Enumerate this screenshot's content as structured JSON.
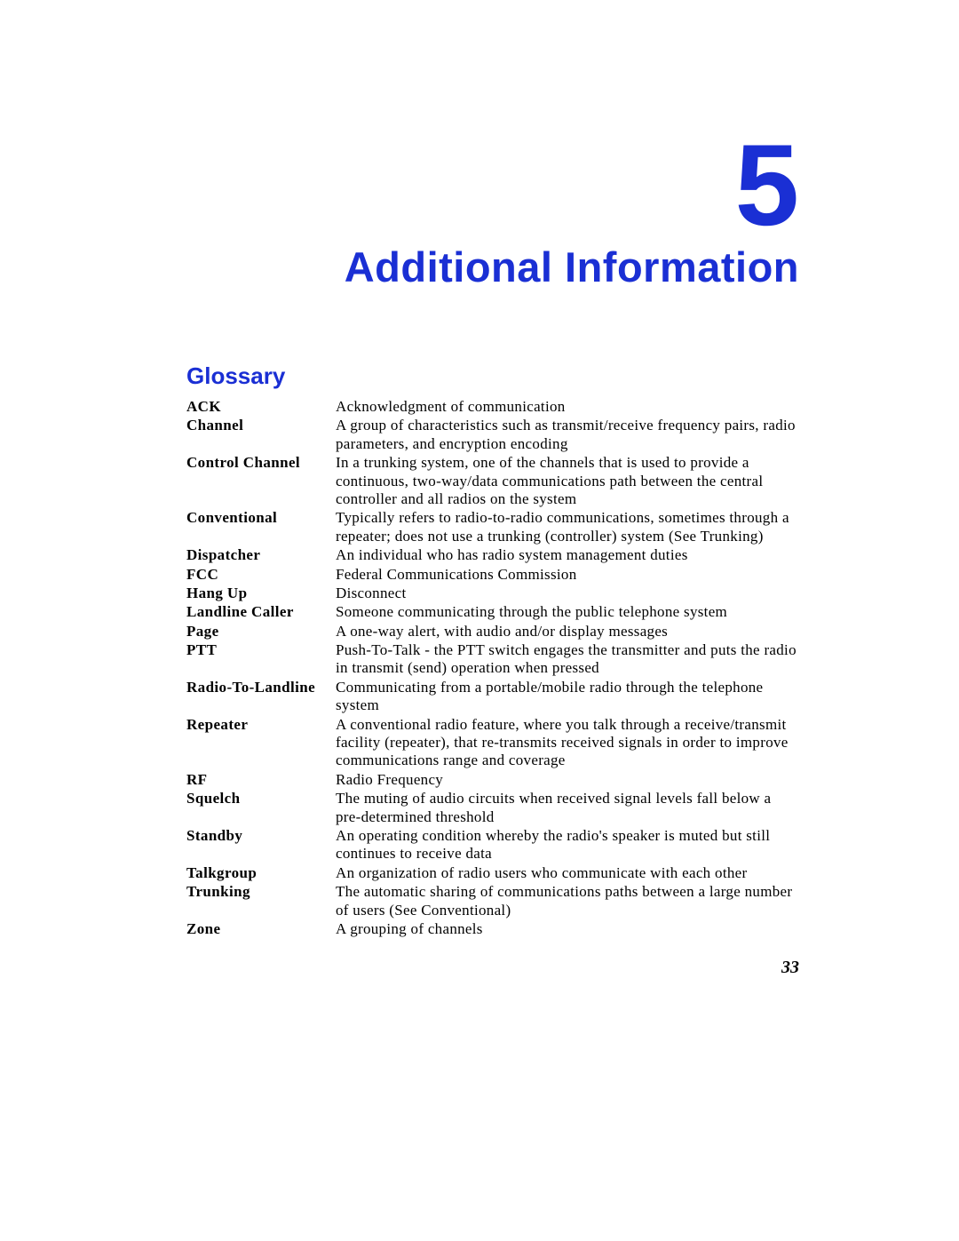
{
  "chapter": {
    "number": "5",
    "title": "Additional Information"
  },
  "section_title": "Glossary",
  "glossary": [
    {
      "term": "ACK",
      "def": "Acknowledgment of communication"
    },
    {
      "term": "Channel",
      "def": "A group of characteristics such as transmit/receive frequency pairs, radio parameters, and encryption encoding"
    },
    {
      "term": "Control Channel",
      "def": "In a trunking system, one of the channels that is used to provide a continuous, two-way/data communications path between the central controller and all radios on the system"
    },
    {
      "term": "Conventional",
      "def": "Typically refers to radio-to-radio communications, sometimes through a repeater; does not use a trunking (controller) system (See Trunking)"
    },
    {
      "term": "Dispatcher",
      "def": "An individual who has radio system management duties"
    },
    {
      "term": "FCC",
      "def": "Federal Communications Commission"
    },
    {
      "term": "Hang Up",
      "def": "Disconnect"
    },
    {
      "term": "Landline Caller",
      "def": "Someone communicating through the public telephone system"
    },
    {
      "term": "Page",
      "def": "A one-way alert, with audio and/or display messages"
    },
    {
      "term": "PTT",
      "def": "Push-To-Talk - the PTT switch engages the transmitter and puts the radio in transmit (send) operation when pressed"
    },
    {
      "term": "Radio-To-Landline",
      "def": "Communicating from a portable/mobile radio through the telephone system"
    },
    {
      "term": "Repeater",
      "def": "A conventional radio feature, where you talk through a receive/transmit facility (repeater), that re-transmits received signals in order to improve communications range and coverage"
    },
    {
      "term": "RF",
      "def": "Radio Frequency"
    },
    {
      "term": "Squelch",
      "def": "The muting of audio circuits when received signal levels fall below a pre-determined threshold"
    },
    {
      "term": "Standby",
      "def": "An operating condition whereby the radio's speaker is muted but still continues to receive data"
    },
    {
      "term": "Talkgroup",
      "def": "An organization of radio users who communicate with each other"
    },
    {
      "term": "Trunking",
      "def": "The automatic sharing of communications paths between a large number of users (See Conventional)"
    },
    {
      "term": "Zone",
      "def": "A grouping of channels"
    }
  ],
  "page_number": "33"
}
